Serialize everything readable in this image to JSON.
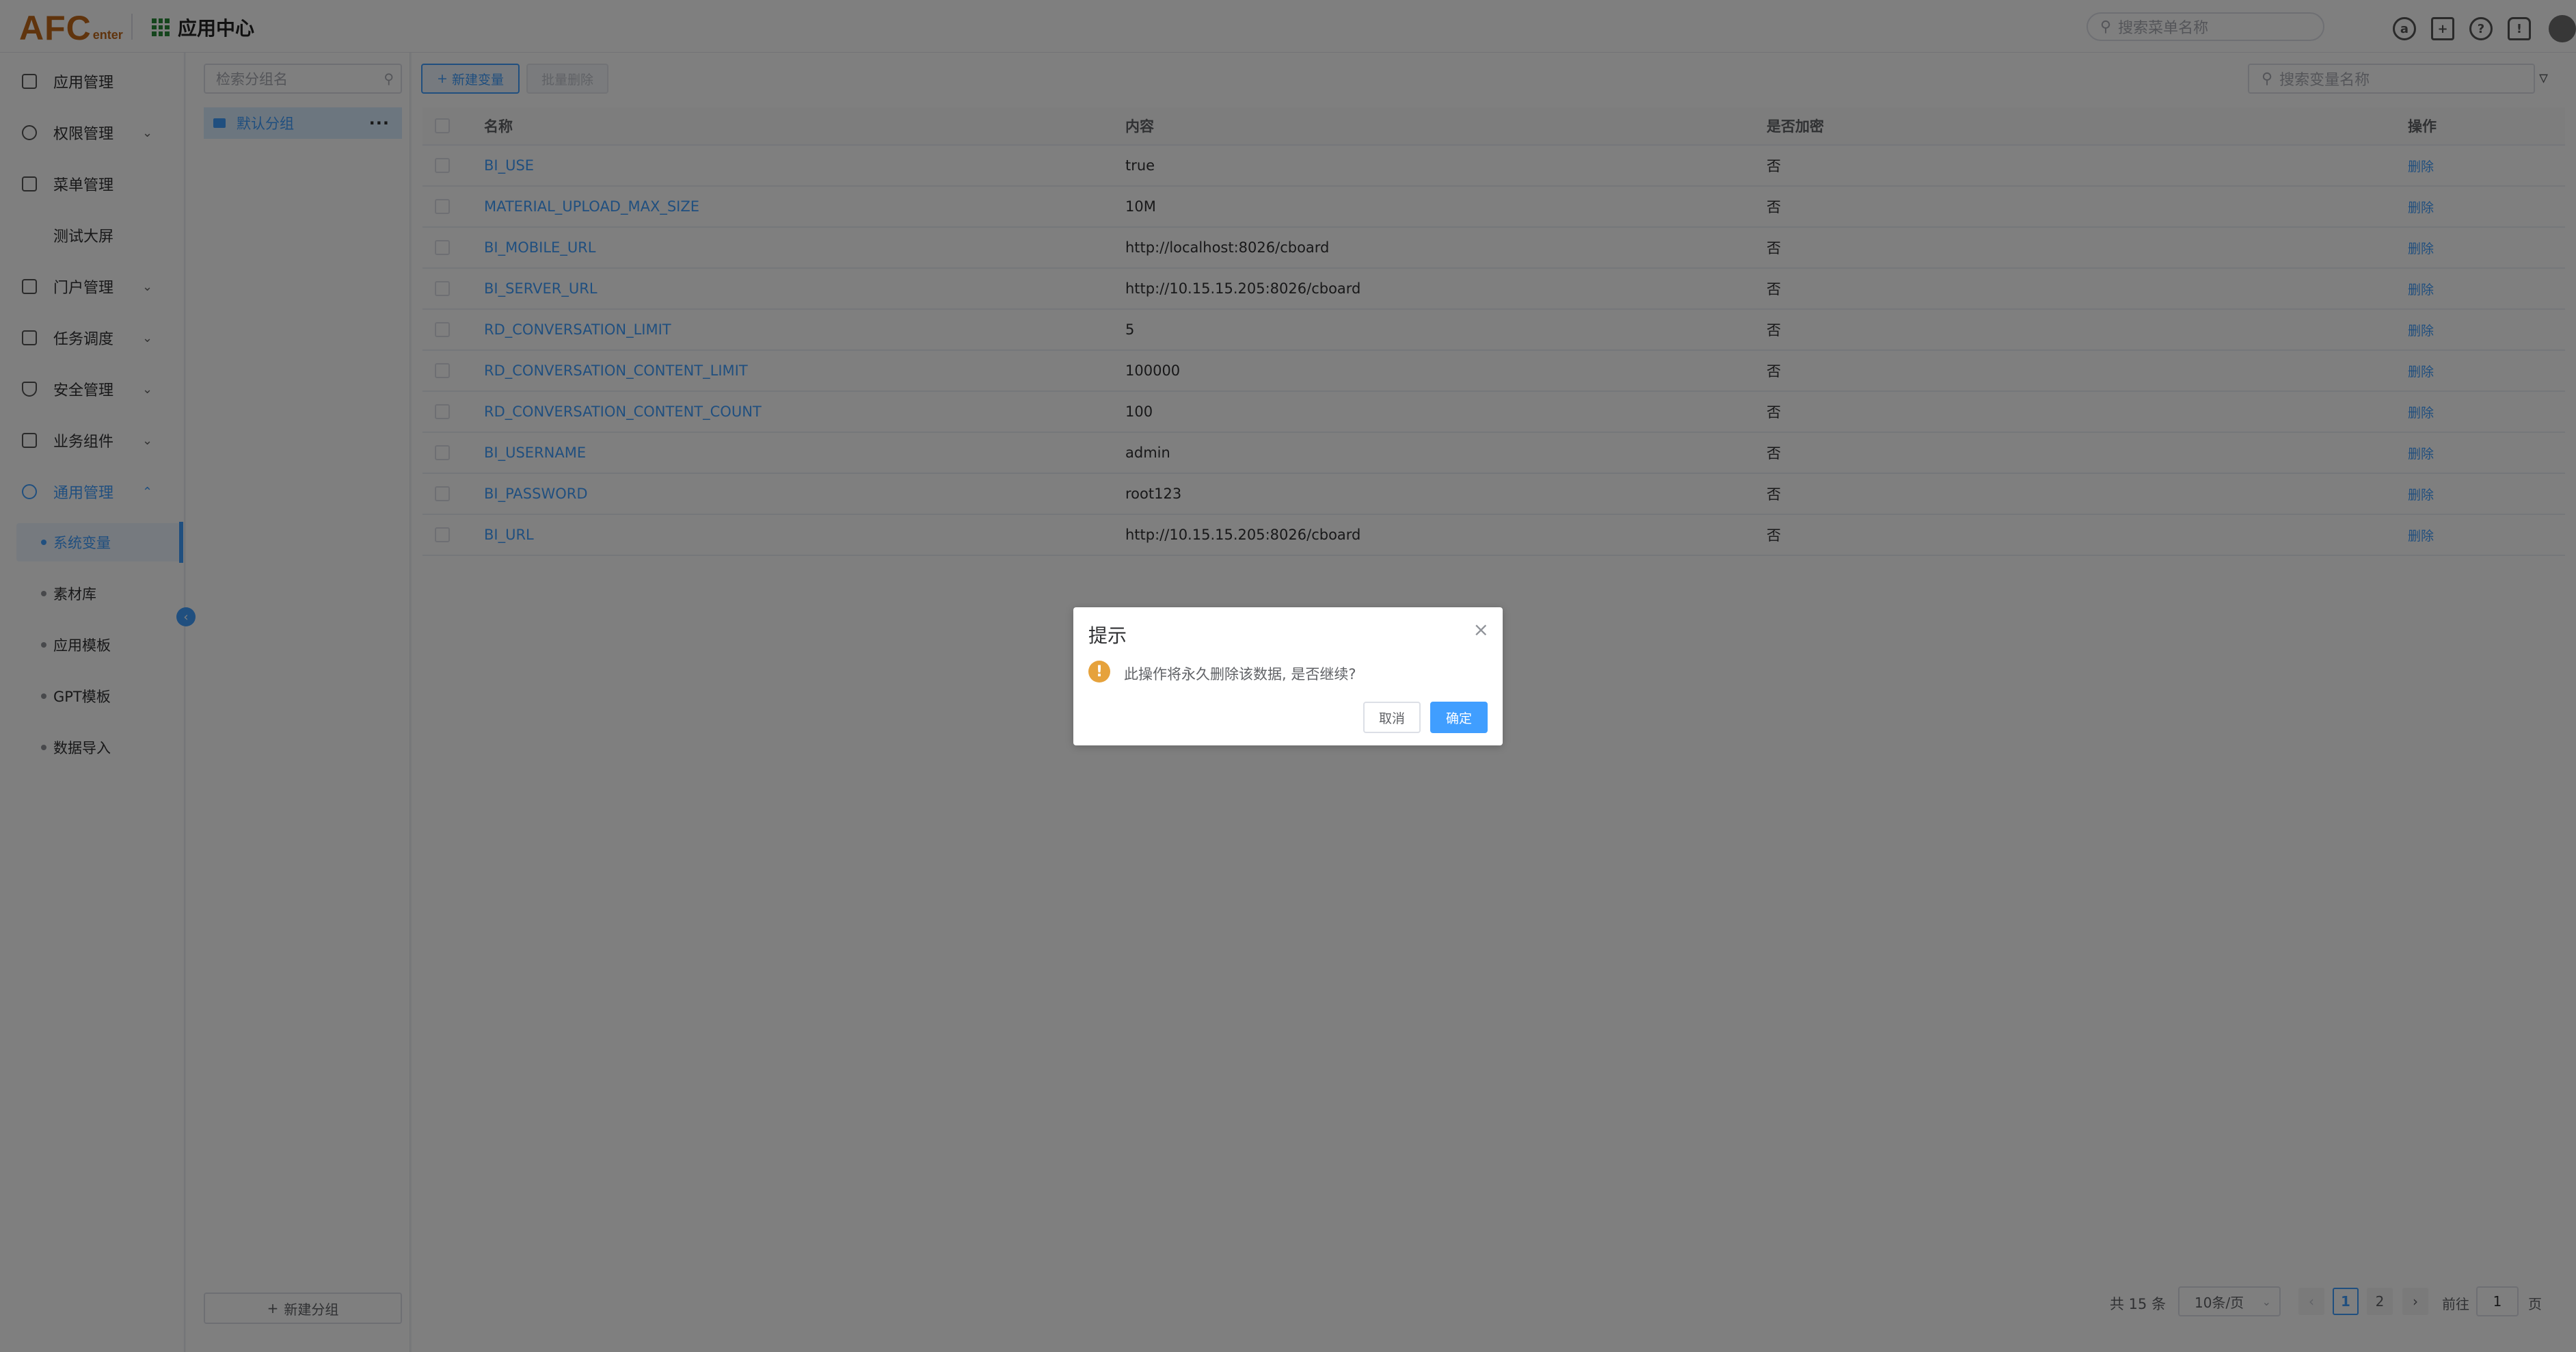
{
  "header": {
    "logo_main": "AFC",
    "logo_sub": "enter",
    "app_title": "应用中心",
    "menu_search_placeholder": "搜索菜单名称"
  },
  "sidebar": {
    "items": [
      {
        "label": "应用管理"
      },
      {
        "label": "权限管理"
      },
      {
        "label": "菜单管理"
      },
      {
        "label": "测试大屏"
      },
      {
        "label": "门户管理"
      },
      {
        "label": "任务调度"
      },
      {
        "label": "安全管理"
      },
      {
        "label": "业务组件"
      },
      {
        "label": "通用管理"
      }
    ],
    "subitems": [
      {
        "label": "系统变量"
      },
      {
        "label": "素材库"
      },
      {
        "label": "应用模板"
      },
      {
        "label": "GPT模板"
      },
      {
        "label": "数据导入"
      }
    ]
  },
  "groups": {
    "search_placeholder": "检索分组名",
    "default_group": "默认分组",
    "new_group_label": "新建分组"
  },
  "toolbar": {
    "new_var_label": "新建变量",
    "batch_delete_label": "批量删除",
    "var_search_placeholder": "搜索变量名称"
  },
  "table": {
    "headers": {
      "name": "名称",
      "content": "内容",
      "encrypted": "是否加密",
      "action": "操作"
    },
    "rows": [
      {
        "name": "BI_USE",
        "content": "true",
        "encrypted": "否",
        "action": "删除"
      },
      {
        "name": "MATERIAL_UPLOAD_MAX_SIZE",
        "content": "10M",
        "encrypted": "否",
        "action": "删除"
      },
      {
        "name": "BI_MOBILE_URL",
        "content": "http://localhost:8026/cboard",
        "encrypted": "否",
        "action": "删除"
      },
      {
        "name": "BI_SERVER_URL",
        "content": "http://10.15.15.205:8026/cboard",
        "encrypted": "否",
        "action": "删除"
      },
      {
        "name": "RD_CONVERSATION_LIMIT",
        "content": "5",
        "encrypted": "否",
        "action": "删除"
      },
      {
        "name": "RD_CONVERSATION_CONTENT_LIMIT",
        "content": "100000",
        "encrypted": "否",
        "action": "删除"
      },
      {
        "name": "RD_CONVERSATION_CONTENT_COUNT",
        "content": "100",
        "encrypted": "否",
        "action": "删除"
      },
      {
        "name": "BI_USERNAME",
        "content": "admin",
        "encrypted": "否",
        "action": "删除"
      },
      {
        "name": "BI_PASSWORD",
        "content": "root123",
        "encrypted": "否",
        "action": "删除"
      },
      {
        "name": "BI_URL",
        "content": "http://10.15.15.205:8026/cboard",
        "encrypted": "否",
        "action": "删除"
      }
    ]
  },
  "pagination": {
    "total": "共 15 条",
    "page_size": "10条/页",
    "pages": [
      "1",
      "2"
    ],
    "goto_prefix": "前往",
    "goto_value": "1",
    "goto_suffix": "页"
  },
  "dialog": {
    "title": "提示",
    "message": "此操作将永久删除该数据, 是否继续?",
    "cancel": "取消",
    "confirm": "确定"
  },
  "colors": {
    "accent": "#409eff",
    "warning": "#e6a23c",
    "brand": "#c0681a"
  }
}
